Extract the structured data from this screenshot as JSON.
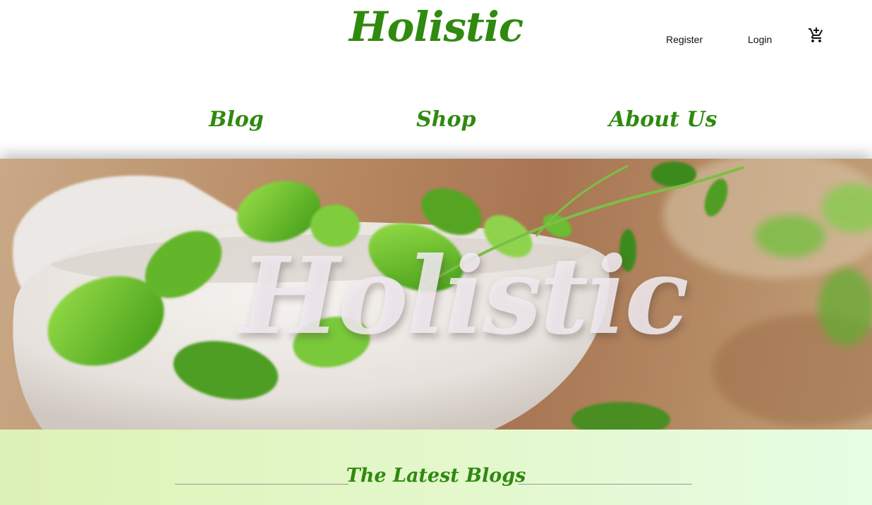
{
  "header": {
    "logo": "Holistic",
    "register_label": "Register",
    "login_label": "Login",
    "cart_icon": "add-shopping-cart-icon"
  },
  "nav": {
    "items": [
      {
        "label": "Blog"
      },
      {
        "label": "Shop"
      },
      {
        "label": "About Us"
      }
    ]
  },
  "hero": {
    "title": "Holistic"
  },
  "latest": {
    "title": "The Latest Blogs"
  },
  "colors": {
    "brand_green": "#2f8a0f",
    "band_start": "#ddf2b6",
    "band_end": "#e6fde4"
  }
}
